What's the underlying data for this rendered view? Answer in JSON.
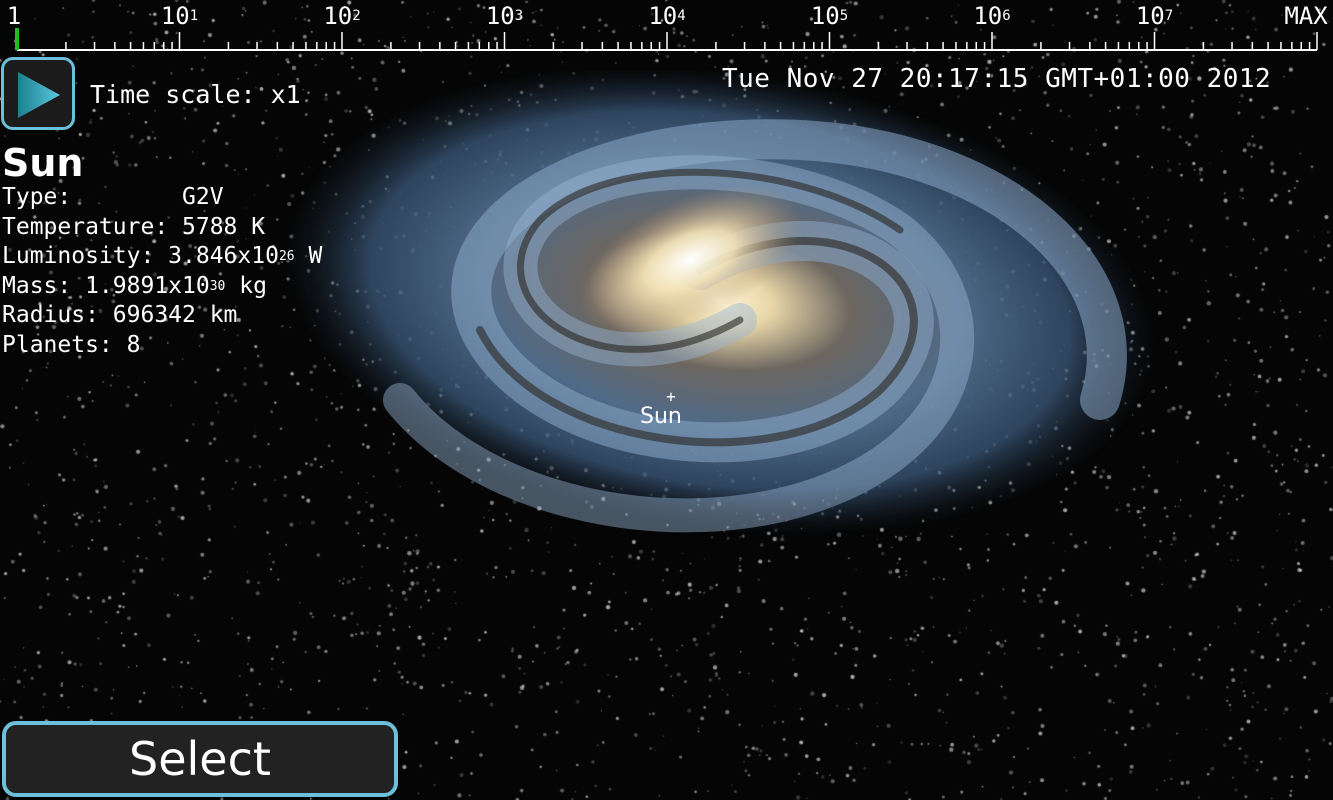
{
  "time_slider": {
    "labels": [
      {
        "base": "1",
        "exp": ""
      },
      {
        "base": "10",
        "exp": "1"
      },
      {
        "base": "10",
        "exp": "2"
      },
      {
        "base": "10",
        "exp": "3"
      },
      {
        "base": "10",
        "exp": "4"
      },
      {
        "base": "10",
        "exp": "5"
      },
      {
        "base": "10",
        "exp": "6"
      },
      {
        "base": "10",
        "exp": "7"
      },
      {
        "base": "MAX",
        "exp": ""
      }
    ],
    "value": 1,
    "indicator_color": "#22bb22"
  },
  "play_button": {
    "icon": "play-icon"
  },
  "time_scale": "Time scale: x1",
  "datetime": "Tue Nov 27 20:17:15 GMT+01:00 2012",
  "object": {
    "name": "Sun",
    "type_label": "Type:",
    "type_value": "G2V",
    "temperature": "Temperature: 5788 K",
    "luminosity_prefix": "Luminosity: 3.846x10",
    "luminosity_exp": "26",
    "luminosity_unit": " W",
    "mass_prefix": "Mass: 1.9891x10",
    "mass_exp": "30",
    "mass_unit": " kg",
    "radius": "Radius: 696342 km",
    "planets": "Planets: 8"
  },
  "marker": {
    "label": "Sun"
  },
  "select_button": "Select",
  "accent_color": "#6cc0dc"
}
